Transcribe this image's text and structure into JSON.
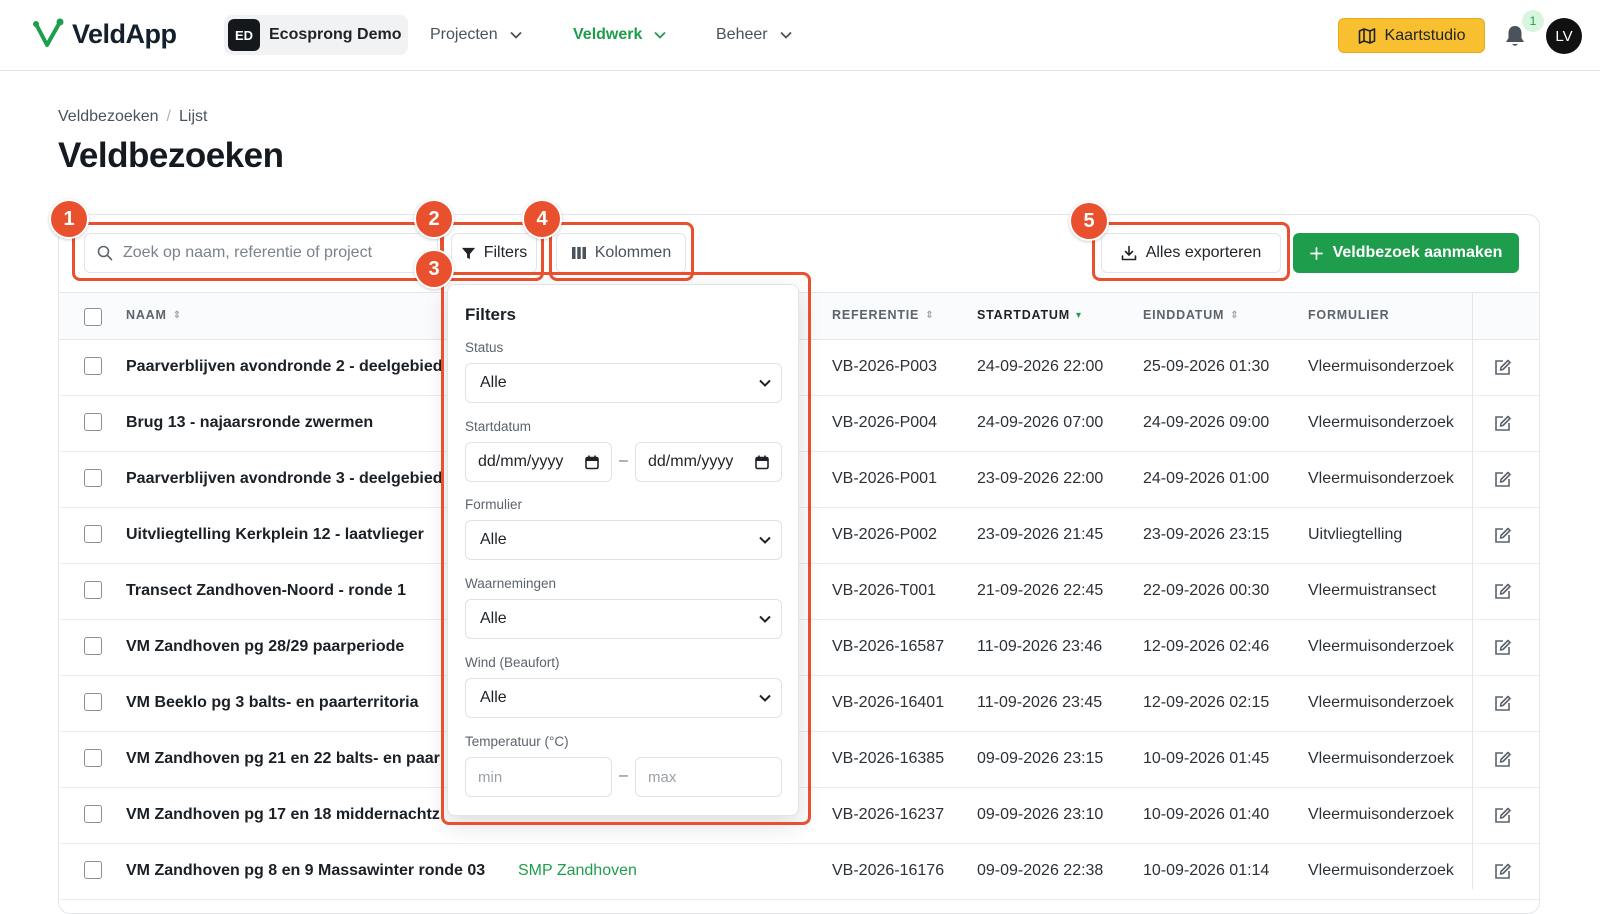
{
  "app": {
    "name": "VeldApp",
    "org_initials": "ED",
    "org_name": "Ecosprong Demo"
  },
  "nav": [
    {
      "label": "Projecten",
      "active": false
    },
    {
      "label": "Veldwerk",
      "active": true
    },
    {
      "label": "Beheer",
      "active": false
    }
  ],
  "header": {
    "kaartstudio_label": "Kaartstudio",
    "notification_count": "1",
    "user_initials": "LV"
  },
  "breadcrumb": {
    "parent": "Veldbezoeken",
    "sep": "/",
    "current": "Lijst"
  },
  "page_title": "Veldbezoeken",
  "toolbar": {
    "search_placeholder": "Zoek op naam, referentie of project",
    "filters_label": "Filters",
    "columns_label": "Kolommen",
    "export_label": "Alles exporteren",
    "create_label": "Veldbezoek aanmaken"
  },
  "table": {
    "headers": {
      "naam": "NAAM",
      "referentie": "REFERENTIE",
      "startdatum": "STARTDATUM",
      "einddatum": "EINDDATUM",
      "formulier": "FORMULIER"
    },
    "rows": [
      {
        "name": "Paarverblijven avondronde 2 - deelgebied",
        "project": "",
        "ref": "VB-2026-P003",
        "start": "24-09-2026 22:00",
        "end": "25-09-2026 01:30",
        "form": "Vleermuisonderzoek"
      },
      {
        "name": "Brug 13 - najaarsronde zwermen",
        "project": "",
        "ref": "VB-2026-P004",
        "start": "24-09-2026 07:00",
        "end": "24-09-2026 09:00",
        "form": "Vleermuisonderzoek"
      },
      {
        "name": "Paarverblijven avondronde 3 - deelgebied",
        "project": "",
        "ref": "VB-2026-P001",
        "start": "23-09-2026 22:00",
        "end": "24-09-2026 01:00",
        "form": "Vleermuisonderzoek"
      },
      {
        "name": "Uitvliegtelling Kerkplein 12 - laatvlieger",
        "project": "",
        "ref": "VB-2026-P002",
        "start": "23-09-2026 21:45",
        "end": "23-09-2026 23:15",
        "form": "Uitvliegtelling"
      },
      {
        "name": "Transect Zandhoven-Noord - ronde 1",
        "project": "",
        "ref": "VB-2026-T001",
        "start": "21-09-2026 22:45",
        "end": "22-09-2026 00:30",
        "form": "Vleermuistransect"
      },
      {
        "name": "VM Zandhoven pg 28/29 paarperiode",
        "project": "",
        "ref": "VB-2026-16587",
        "start": "11-09-2026 23:46",
        "end": "12-09-2026 02:46",
        "form": "Vleermuisonderzoek"
      },
      {
        "name": "VM Beeklo pg 3 balts- en paarterritoria",
        "project": "",
        "ref": "VB-2026-16401",
        "start": "11-09-2026 23:45",
        "end": "12-09-2026 02:15",
        "form": "Vleermuisonderzoek"
      },
      {
        "name": "VM Zandhoven pg 21 en 22 balts- en paar",
        "project": "",
        "ref": "VB-2026-16385",
        "start": "09-09-2026 23:15",
        "end": "10-09-2026 01:45",
        "form": "Vleermuisonderzoek"
      },
      {
        "name": "VM Zandhoven pg 17 en 18 middernachtz",
        "project": "",
        "ref": "VB-2026-16237",
        "start": "09-09-2026 23:10",
        "end": "10-09-2026 01:40",
        "form": "Vleermuisonderzoek"
      },
      {
        "name": "VM Zandhoven pg 8 en 9 Massawinter ronde 03",
        "project": "SMP Zandhoven",
        "ref": "VB-2026-16176",
        "start": "09-09-2026 22:38",
        "end": "10-09-2026 01:14",
        "form": "Vleermuisonderzoek"
      }
    ]
  },
  "filters": {
    "title": "Filters",
    "status_label": "Status",
    "status_value": "Alle",
    "startdatum_label": "Startdatum",
    "date_from": "dd/mm/yyyy",
    "date_sep": "–",
    "date_to": "dd/mm/yyyy",
    "formulier_label": "Formulier",
    "formulier_value": "Alle",
    "waarnemingen_label": "Waarnemingen",
    "waarnemingen_value": "Alle",
    "wind_label": "Wind (Beaufort)",
    "wind_value": "Alle",
    "temp_label": "Temperatuur (°C)",
    "temp_min": "min",
    "temp_sep": "–",
    "temp_max": "max"
  },
  "annotations": [
    "1",
    "2",
    "3",
    "4",
    "5"
  ],
  "colors": {
    "brand_green": "#1e9e4c",
    "accent_yellow": "#f8c030",
    "highlight": "#e8502e"
  }
}
